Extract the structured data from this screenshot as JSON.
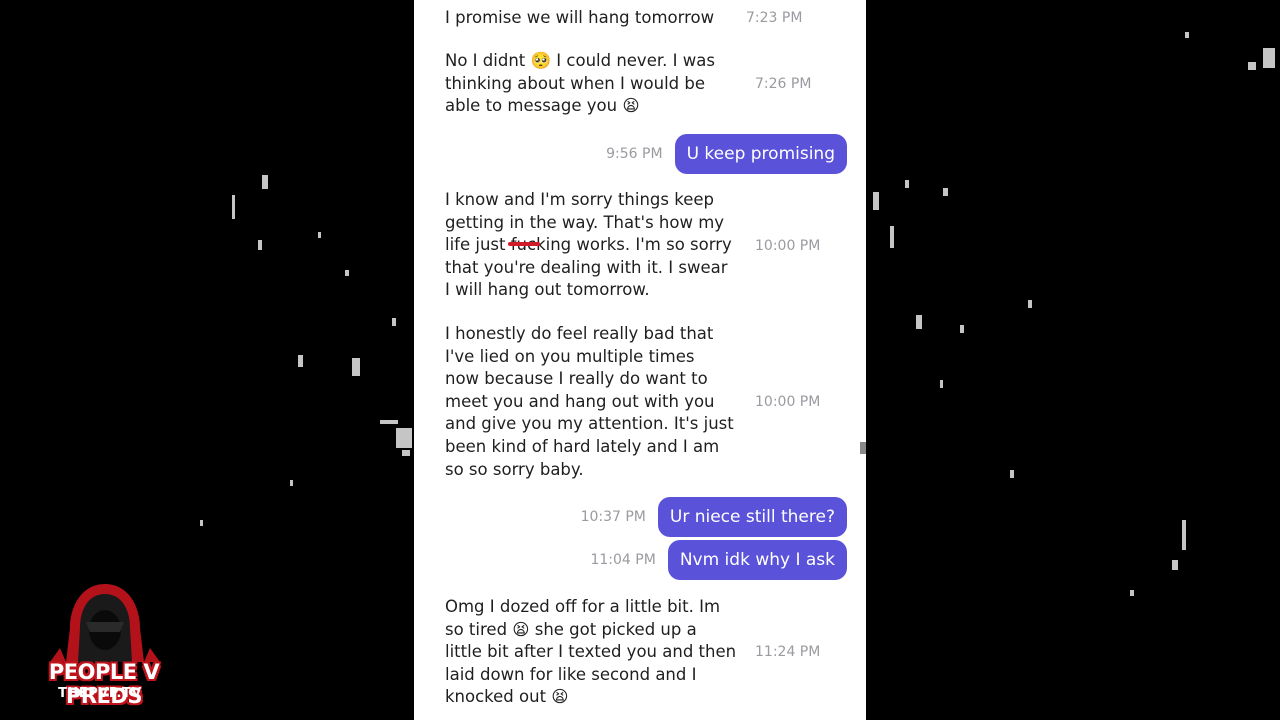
{
  "messages": [
    {
      "type": "received",
      "text": "I promise we will hang tomorrow",
      "time": "7:23 PM"
    },
    {
      "type": "received",
      "text": "No I didnt 🥺 I could never. I was\nthinking about when I would be\nable to message you 😫",
      "time": "7:26 PM"
    },
    {
      "type": "sent",
      "text": "U keep promising",
      "time": "9:56 PM"
    },
    {
      "type": "received",
      "text": "I know and I'm sorry things keep\ngetting in the way. That's how my\nlife just fucking works. I'm so sorry\nthat you're dealing with it. I swear\nI will hang out tomorrow.",
      "time": "10:00 PM"
    },
    {
      "type": "received",
      "text": "I honestly do feel really bad that\nI've lied on you multiple times\nnow because I really do want to\nmeet you and hang out with you\nand give you my attention. It's just\nbeen kind of hard lately and I am\nso so sorry baby.",
      "time": "10:00 PM"
    },
    {
      "type": "sent",
      "text": "Ur niece still there?",
      "time": "10:37 PM"
    },
    {
      "type": "sent",
      "text": "Nvm idk why I ask",
      "time": "11:04 PM"
    },
    {
      "type": "received",
      "text": "Omg I dozed off for a little bit. Im\nso tired 😫 she got picked up a\nlittle bit after I texted you and then\nlaid down for like second and I\nknocked out 😫",
      "time": "11:24 PM"
    }
  ],
  "logo": {
    "line1": "PEOPLE V PREDS",
    "line2": "THEPVP.TV",
    "icon": "hooded-figure-icon"
  },
  "colors": {
    "sent_bubble": "#5a52d8",
    "timestamp": "#9a9aa0",
    "redaction": "#d11a2a"
  }
}
